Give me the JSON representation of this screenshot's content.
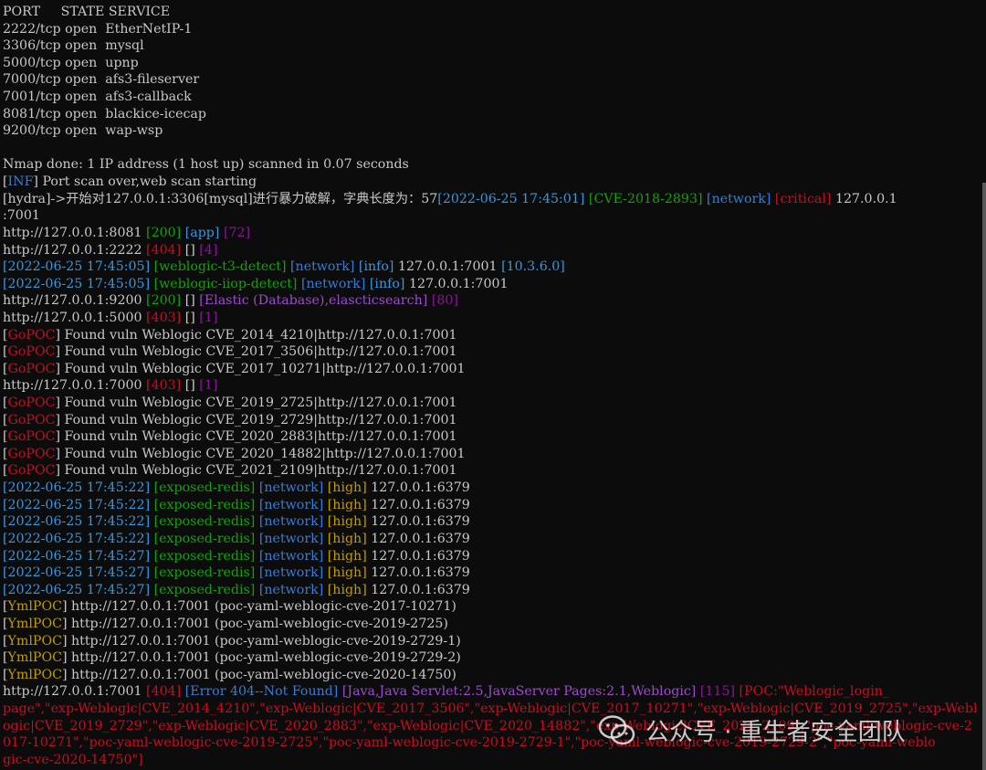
{
  "terminal": {
    "lines": [
      [
        [
          "PORT     STATE SERVICE",
          "gray"
        ]
      ],
      [
        [
          "2222/tcp open  EtherNetIP-1",
          "gray"
        ]
      ],
      [
        [
          "3306/tcp open  mysql",
          "gray"
        ]
      ],
      [
        [
          "5000/tcp open  upnp",
          "gray"
        ]
      ],
      [
        [
          "7000/tcp open  afs3-fileserver",
          "gray"
        ]
      ],
      [
        [
          "7001/tcp open  afs3-callback",
          "gray"
        ]
      ],
      [
        [
          "8081/tcp open  blackice-icecap",
          "gray"
        ]
      ],
      [
        [
          "9200/tcp open  wap-wsp",
          "gray"
        ]
      ],
      [],
      [
        [
          "Nmap done: 1 IP address (1 host up) scanned in 0.07 seconds",
          "gray"
        ]
      ],
      [
        [
          "[",
          "gray"
        ],
        [
          "INF",
          "blue"
        ],
        [
          "] Port scan over,web scan starting",
          "gray"
        ]
      ],
      [
        [
          "[hydra]->开始对127.0.0.1:3306[mysql]进行暴力破解，字典长度为：57",
          "gray"
        ],
        [
          "[2022-06-25 17:45:01]",
          "cyan"
        ],
        [
          " ",
          "gray"
        ],
        [
          "[CVE-2018-2893]",
          "green"
        ],
        [
          " ",
          "gray"
        ],
        [
          "[network]",
          "blue"
        ],
        [
          " ",
          "gray"
        ],
        [
          "[critical]",
          "red"
        ],
        [
          " 127.0.0.1",
          "gray"
        ]
      ],
      [
        [
          ":7001",
          "gray"
        ]
      ],
      [
        [
          "http://127.0.0.1:8081 ",
          "gray"
        ],
        [
          "[200]",
          "green"
        ],
        [
          " ",
          "gray"
        ],
        [
          "[app]",
          "cyan"
        ],
        [
          " ",
          "gray"
        ],
        [
          "[72]",
          "magenta"
        ]
      ],
      [
        [
          "http://127.0.0.1:2222 ",
          "gray"
        ],
        [
          "[404]",
          "red"
        ],
        [
          " [] ",
          "gray"
        ],
        [
          "[4]",
          "magenta"
        ]
      ],
      [
        [
          "[2022-06-25 17:45:05]",
          "cyan"
        ],
        [
          " ",
          "gray"
        ],
        [
          "[weblogic-t3-detect]",
          "green"
        ],
        [
          " ",
          "gray"
        ],
        [
          "[network]",
          "blue"
        ],
        [
          " ",
          "gray"
        ],
        [
          "[info]",
          "cyan"
        ],
        [
          " 127.0.0.1:7001 ",
          "gray"
        ],
        [
          "[10.3.6.0]",
          "cyan"
        ]
      ],
      [
        [
          "[2022-06-25 17:45:05]",
          "cyan"
        ],
        [
          " ",
          "gray"
        ],
        [
          "[weblogic-iiop-detect]",
          "green"
        ],
        [
          " ",
          "gray"
        ],
        [
          "[network]",
          "blue"
        ],
        [
          " ",
          "gray"
        ],
        [
          "[info]",
          "cyan"
        ],
        [
          " 127.0.0.1:7001",
          "gray"
        ]
      ],
      [
        [
          "http://127.0.0.1:9200 ",
          "gray"
        ],
        [
          "[200]",
          "green"
        ],
        [
          " [] ",
          "gray"
        ],
        [
          "[Elastic (Database),elascticsearch]",
          "purple"
        ],
        [
          " ",
          "gray"
        ],
        [
          "[80]",
          "magenta"
        ]
      ],
      [
        [
          "http://127.0.0.1:5000 ",
          "gray"
        ],
        [
          "[403]",
          "red"
        ],
        [
          " [] ",
          "gray"
        ],
        [
          "[1]",
          "magenta"
        ]
      ],
      [
        [
          "[",
          "gray"
        ],
        [
          "GoPOC",
          "red"
        ],
        [
          "] Found vuln Weblogic CVE_2014_4210|http://127.0.0.1:7001",
          "gray"
        ]
      ],
      [
        [
          "[",
          "gray"
        ],
        [
          "GoPOC",
          "red"
        ],
        [
          "] Found vuln Weblogic CVE_2017_3506|http://127.0.0.1:7001",
          "gray"
        ]
      ],
      [
        [
          "[",
          "gray"
        ],
        [
          "GoPOC",
          "red"
        ],
        [
          "] Found vuln Weblogic CVE_2017_10271|http://127.0.0.1:7001",
          "gray"
        ]
      ],
      [
        [
          "http://127.0.0.1:7000 ",
          "gray"
        ],
        [
          "[403]",
          "red"
        ],
        [
          " [] ",
          "gray"
        ],
        [
          "[1]",
          "magenta"
        ]
      ],
      [
        [
          "[",
          "gray"
        ],
        [
          "GoPOC",
          "red"
        ],
        [
          "] Found vuln Weblogic CVE_2019_2725|http://127.0.0.1:7001",
          "gray"
        ]
      ],
      [
        [
          "[",
          "gray"
        ],
        [
          "GoPOC",
          "red"
        ],
        [
          "] Found vuln Weblogic CVE_2019_2729|http://127.0.0.1:7001",
          "gray"
        ]
      ],
      [
        [
          "[",
          "gray"
        ],
        [
          "GoPOC",
          "red"
        ],
        [
          "] Found vuln Weblogic CVE_2020_2883|http://127.0.0.1:7001",
          "gray"
        ]
      ],
      [
        [
          "[",
          "gray"
        ],
        [
          "GoPOC",
          "red"
        ],
        [
          "] Found vuln Weblogic CVE_2020_14882|http://127.0.0.1:7001",
          "gray"
        ]
      ],
      [
        [
          "[",
          "gray"
        ],
        [
          "GoPOC",
          "red"
        ],
        [
          "] Found vuln Weblogic CVE_2021_2109|http://127.0.0.1:7001",
          "gray"
        ]
      ],
      [
        [
          "[2022-06-25 17:45:22]",
          "cyan"
        ],
        [
          " ",
          "gray"
        ],
        [
          "[exposed-redis]",
          "green"
        ],
        [
          " ",
          "gray"
        ],
        [
          "[network]",
          "blue"
        ],
        [
          " ",
          "gray"
        ],
        [
          "[high]",
          "yellow"
        ],
        [
          " 127.0.0.1:6379",
          "gray"
        ]
      ],
      [
        [
          "[2022-06-25 17:45:22]",
          "cyan"
        ],
        [
          " ",
          "gray"
        ],
        [
          "[exposed-redis]",
          "green"
        ],
        [
          " ",
          "gray"
        ],
        [
          "[network]",
          "blue"
        ],
        [
          " ",
          "gray"
        ],
        [
          "[high]",
          "yellow"
        ],
        [
          " 127.0.0.1:6379",
          "gray"
        ]
      ],
      [
        [
          "[2022-06-25 17:45:22]",
          "cyan"
        ],
        [
          " ",
          "gray"
        ],
        [
          "[exposed-redis]",
          "green"
        ],
        [
          " ",
          "gray"
        ],
        [
          "[network]",
          "blue"
        ],
        [
          " ",
          "gray"
        ],
        [
          "[high]",
          "yellow"
        ],
        [
          " 127.0.0.1:6379",
          "gray"
        ]
      ],
      [
        [
          "[2022-06-25 17:45:22]",
          "cyan"
        ],
        [
          " ",
          "gray"
        ],
        [
          "[exposed-redis]",
          "green"
        ],
        [
          " ",
          "gray"
        ],
        [
          "[network]",
          "blue"
        ],
        [
          " ",
          "gray"
        ],
        [
          "[high]",
          "yellow"
        ],
        [
          " 127.0.0.1:6379",
          "gray"
        ]
      ],
      [
        [
          "[2022-06-25 17:45:27]",
          "cyan"
        ],
        [
          " ",
          "gray"
        ],
        [
          "[exposed-redis]",
          "green"
        ],
        [
          " ",
          "gray"
        ],
        [
          "[network]",
          "blue"
        ],
        [
          " ",
          "gray"
        ],
        [
          "[high]",
          "yellow"
        ],
        [
          " 127.0.0.1:6379",
          "gray"
        ]
      ],
      [
        [
          "[2022-06-25 17:45:27]",
          "cyan"
        ],
        [
          " ",
          "gray"
        ],
        [
          "[exposed-redis]",
          "green"
        ],
        [
          " ",
          "gray"
        ],
        [
          "[network]",
          "blue"
        ],
        [
          " ",
          "gray"
        ],
        [
          "[high]",
          "yellow"
        ],
        [
          " 127.0.0.1:6379",
          "gray"
        ]
      ],
      [
        [
          "[2022-06-25 17:45:27]",
          "cyan"
        ],
        [
          " ",
          "gray"
        ],
        [
          "[exposed-redis]",
          "green"
        ],
        [
          " ",
          "gray"
        ],
        [
          "[network]",
          "blue"
        ],
        [
          " ",
          "gray"
        ],
        [
          "[high]",
          "yellow"
        ],
        [
          " 127.0.0.1:6379",
          "gray"
        ]
      ],
      [
        [
          "[",
          "gray"
        ],
        [
          "YmlPOC",
          "yellow"
        ],
        [
          "] http://127.0.0.1:7001 (poc-yaml-weblogic-cve-2017-10271)",
          "gray"
        ]
      ],
      [
        [
          "[",
          "gray"
        ],
        [
          "YmlPOC",
          "yellow"
        ],
        [
          "] http://127.0.0.1:7001 (poc-yaml-weblogic-cve-2019-2725)",
          "gray"
        ]
      ],
      [
        [
          "[",
          "gray"
        ],
        [
          "YmlPOC",
          "yellow"
        ],
        [
          "] http://127.0.0.1:7001 (poc-yaml-weblogic-cve-2019-2729-1)",
          "gray"
        ]
      ],
      [
        [
          "[",
          "gray"
        ],
        [
          "YmlPOC",
          "yellow"
        ],
        [
          "] http://127.0.0.1:7001 (poc-yaml-weblogic-cve-2019-2729-2)",
          "gray"
        ]
      ],
      [
        [
          "[",
          "gray"
        ],
        [
          "YmlPOC",
          "yellow"
        ],
        [
          "] http://127.0.0.1:7001 (poc-yaml-weblogic-cve-2020-14750)",
          "gray"
        ]
      ],
      [
        [
          "http://127.0.0.1:7001 ",
          "gray"
        ],
        [
          "[404]",
          "red"
        ],
        [
          " ",
          "gray"
        ],
        [
          "[Error 404--Not Found]",
          "blue"
        ],
        [
          " ",
          "gray"
        ],
        [
          "[Java,Java Servlet:2.5,JavaServer Pages:2.1,Weblogic]",
          "purple"
        ],
        [
          " ",
          "gray"
        ],
        [
          "[115]",
          "magenta"
        ],
        [
          " ",
          "gray"
        ],
        [
          "[POC:\"Weblogic_login_",
          "red"
        ]
      ],
      [
        [
          "page\",\"exp-Weblogic|CVE_2014_4210\",\"exp-Weblogic|CVE_2017_3506\",\"exp-Weblogic|CVE_2017_10271\",\"exp-Weblogic|CVE_2019_2725\",\"exp-Webl",
          "red"
        ]
      ],
      [
        [
          "ogic|CVE_2019_2729\",\"exp-Weblogic|CVE_2020_2883\",\"exp-Weblogic|CVE_2020_14882\",\"exp-Weblogic|CVE_2021_2109\",\"poc-yaml-weblogic-cve-2",
          "red"
        ]
      ],
      [
        [
          "017-10271\",\"poc-yaml-weblogic-cve-2019-2725\",\"poc-yaml-weblogic-cve-2019-2729-1\",\"poc-yaml-weblogic-cve-2019-2729-2\",\"poc-yaml-weblo",
          "red"
        ]
      ],
      [
        [
          "gic-cve-2020-14750\"]",
          "red"
        ]
      ]
    ]
  },
  "colors": {
    "gray": "#c8c8c8",
    "blue": "#3a7bd5",
    "cyan": "#3a96dd",
    "green": "#13a10e",
    "yellow": "#c19c00",
    "red": "#c50f1f",
    "magenta": "#881798",
    "purple": "#9b4dca"
  },
  "watermark": {
    "icon": "wechat-icon",
    "text": "公众号 · 重生者安全团队"
  }
}
